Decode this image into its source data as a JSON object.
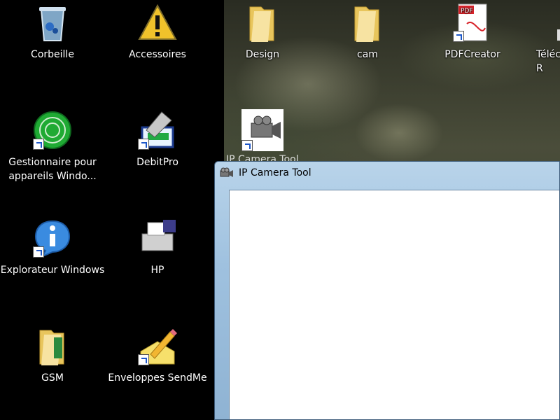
{
  "desktop_icons": [
    {
      "id": "corbeille",
      "label": "Corbeille"
    },
    {
      "id": "accessoires",
      "label": "Accessoires"
    },
    {
      "id": "design",
      "label": "Design"
    },
    {
      "id": "cam",
      "label": "cam"
    },
    {
      "id": "pdfcreator",
      "label": "PDFCreator"
    },
    {
      "id": "telecommande",
      "label": "Téléc\nR"
    },
    {
      "id": "gestionnaire",
      "label": "Gestionnaire pour\nappareils Windo..."
    },
    {
      "id": "debitpro",
      "label": "DebitPro"
    },
    {
      "id": "ipcameratool",
      "label": "IP Camera Tool"
    },
    {
      "id": "explorateur",
      "label": "Explorateur Windows"
    },
    {
      "id": "hp",
      "label": "HP"
    },
    {
      "id": "gsm",
      "label": "GSM"
    },
    {
      "id": "enveloppes",
      "label": "Enveloppes SendMe"
    }
  ],
  "window": {
    "title": "IP Camera Tool"
  },
  "colors": {
    "folder": "#f2d36b",
    "window_frame": "#a8c8e4",
    "client_bg": "#ffffff"
  }
}
